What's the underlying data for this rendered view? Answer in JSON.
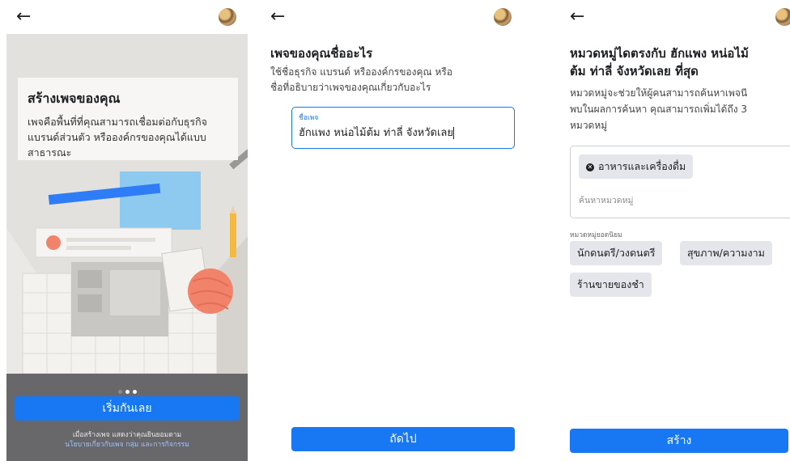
{
  "screen1": {
    "card_title": "สร้างเพจของคุณ",
    "card_desc": "เพจคือพื้นที่ที่คุณสามารถเชื่อมต่อกับธุรกิจ แบรนด์ส่วนตัว หรือองค์กรของคุณได้แบบสาธารณะ",
    "start_button": "เริ่มกันเลย",
    "legal_line1": "เมื่อสร้างเพจ แสดงว่าคุณยินยอมตาม",
    "legal_link": "นโยบายเกี่ยวกับเพจ กลุ่ม และการกิจกรรม",
    "colors": {
      "primary": "#1877f2",
      "panel": "#68686a"
    }
  },
  "screen2": {
    "heading": "เพจของคุณชื่ออะไร",
    "desc_line1": "ใช้ชื่อธุรกิจ แบรนด์ หรือองค์กรของคุณ หรือ",
    "desc_line2": "ชื่อที่อธิบายว่าเพจของคุณเกี่ยวกับอะไร",
    "field_label": "ชื่อเพจ",
    "field_value": "ฮักแพง หน่อไม้ต้ม ท่าลี่ จังหวัดเลย",
    "next_button": "ถัดไป"
  },
  "screen3": {
    "heading_line1": "หมวดหมู่ไดตรงกับ ฮักแพง หน่อไม้",
    "heading_line2": "ต้ม ท่าลี่ จังหวัดเลย ที่สุด",
    "desc_line1": "หมวดหมู่จะช่วยให้ผู้คนสามารถค้นหาเพจนี",
    "desc_line2": "พบในผลการค้นหา คุณสามารถเพิ่มได้ถึง 3",
    "desc_line3": "หมวดหมู่",
    "selected_chip": "อาหารและเครื่องดื่ม",
    "search_placeholder": "ค้นหาหมวดหมู่",
    "popular_label": "หมวดหมู่ยอดนิยม",
    "popular": [
      "นักดนตรี/วงดนตรี",
      "สุขภาพ/ความงาม",
      "ร้านขายของชำ"
    ],
    "create_button": "สร้าง"
  }
}
